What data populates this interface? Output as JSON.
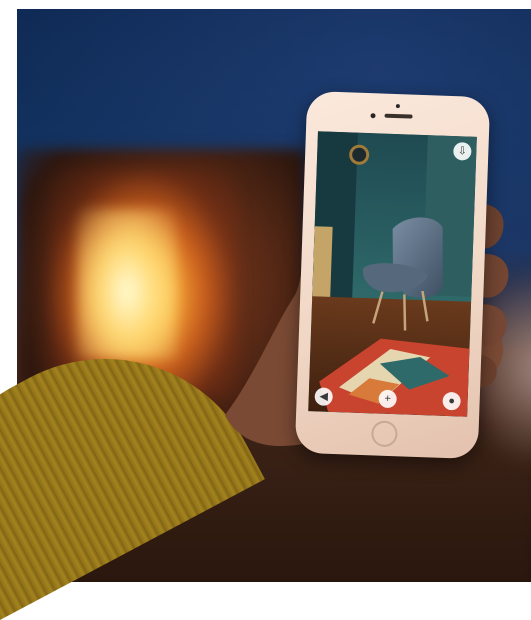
{
  "scene": {
    "type": "photograph",
    "ar_app_icons": {
      "top_right": "share-icon",
      "bottom_left": "back-icon",
      "bottom_center": "add-icon",
      "bottom_right": "user-icon"
    },
    "colors": {
      "wall": "#13325f",
      "fire": "#ffb43c",
      "sleeve": "#a4841f",
      "phone_body": "#f0d6c4",
      "chair": "#5b6f84",
      "rug_red": "#c8442e"
    }
  }
}
